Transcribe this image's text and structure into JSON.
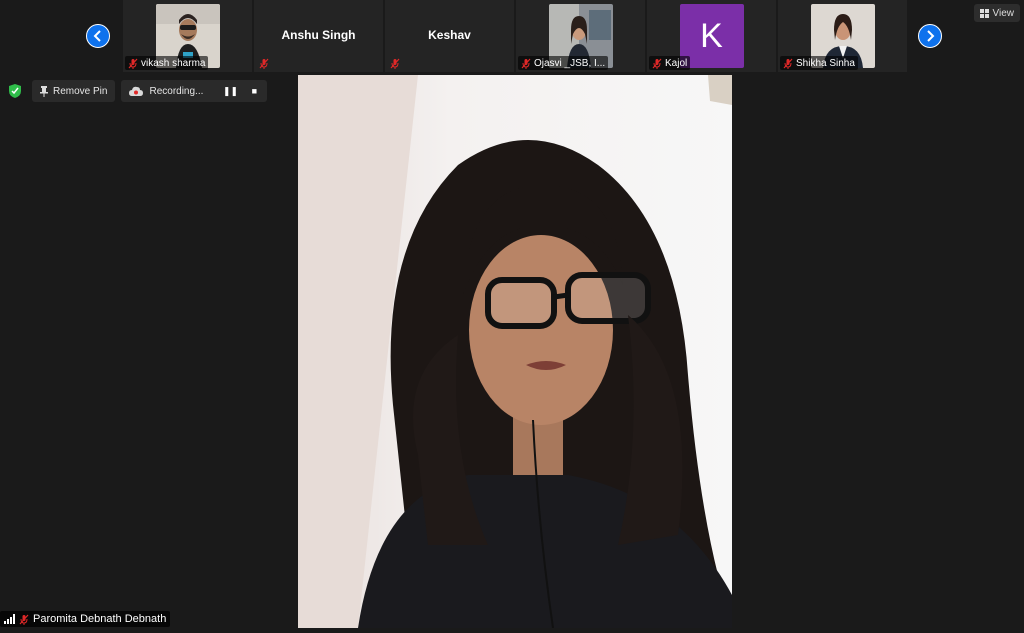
{
  "participants": [
    {
      "name": "vikash sharma",
      "kind": "video"
    },
    {
      "name": "Anshu Singh",
      "kind": "name"
    },
    {
      "name": "Keshav",
      "kind": "name"
    },
    {
      "name": "Ojasvi _JSB, I...",
      "kind": "video"
    },
    {
      "name": "Kajol",
      "kind": "avatar",
      "initial": "K",
      "color": "#7b2fa8"
    },
    {
      "name": "Shikha Sinha",
      "kind": "video"
    }
  ],
  "controls": {
    "view_label": "View",
    "remove_pin_label": "Remove Pin",
    "recording_label": "Recording...",
    "pause_symbol": "❚❚",
    "stop_symbol": "■"
  },
  "main_speaker": {
    "name": "Paromita Debnath Debnath"
  },
  "colors": {
    "accent": "#0e72ed",
    "muted_mic": "#e02828",
    "shield": "#2fbd4a"
  }
}
